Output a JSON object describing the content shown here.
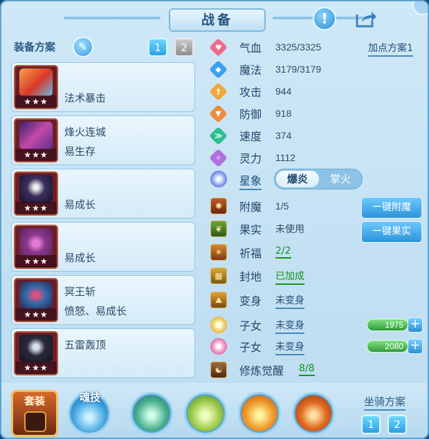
{
  "header": {
    "title": "战备"
  },
  "left_panel": {
    "heading": "装备方案",
    "plan_tabs": [
      "1",
      "2"
    ],
    "equipment": [
      {
        "line1": "",
        "line2": "法术暴击",
        "stars": "★★★"
      },
      {
        "line1": "烽火连城",
        "line2": "易生存",
        "stars": "★★★"
      },
      {
        "line1": "",
        "line2": "易成长",
        "stars": "★★★"
      },
      {
        "line1": "",
        "line2": "易成长",
        "stars": "★★★"
      },
      {
        "line1": "冥王斩",
        "line2": "愤怒、易成长",
        "stars": "★★★"
      },
      {
        "line1": "五雷轰顶",
        "line2": "",
        "stars": "★★★"
      }
    ]
  },
  "stats": {
    "scheme_link": "加点方案1",
    "rows": [
      {
        "name": "气血",
        "value": "3325/3325",
        "icon": "heart-icon"
      },
      {
        "name": "魔法",
        "value": "3179/3179",
        "icon": "mana-icon"
      },
      {
        "name": "攻击",
        "value": "944",
        "icon": "sword-icon"
      },
      {
        "name": "防御",
        "value": "918",
        "icon": "shield-icon"
      },
      {
        "name": "速度",
        "value": "374",
        "icon": "speed-icon"
      },
      {
        "name": "灵力",
        "value": "1112",
        "icon": "spirit-icon"
      }
    ],
    "star_sign": {
      "label": "星象",
      "option_on": "爆炎",
      "option_off": "掌火"
    }
  },
  "features": {
    "enchant": {
      "label": "附魔",
      "value": "1/5",
      "button": "一键附魔"
    },
    "fruit": {
      "label": "果实",
      "value": "未使用",
      "button": "一键果实"
    },
    "blessing": {
      "label": "祈福",
      "value": "2/2"
    },
    "fief": {
      "label": "封地",
      "value": "已加成"
    },
    "transform": {
      "label": "变身",
      "value": "未变身"
    },
    "child1": {
      "label": "子女",
      "value": "未变身",
      "bar_value": "1975"
    },
    "child2": {
      "label": "子女",
      "value": "未变身",
      "bar_value": "2080"
    },
    "cultivation": {
      "label": "修炼觉醒",
      "value": "8/8"
    }
  },
  "bottom": {
    "set_label": "套装",
    "soul_label": "魂技",
    "mount_title": "坐骑方案",
    "mount_tabs": [
      "1",
      "2"
    ]
  },
  "colors": {
    "accent": "#2aa0e2",
    "green": "#16931a",
    "text": "#24486a"
  }
}
